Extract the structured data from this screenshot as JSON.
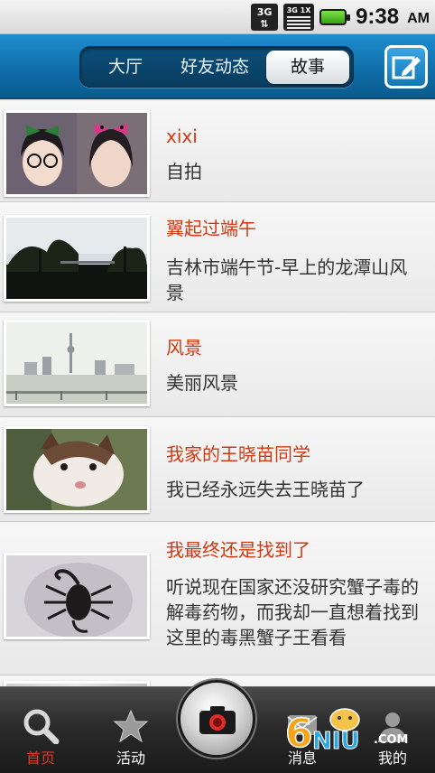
{
  "status_bar": {
    "network": "3G",
    "signal_tag": "3G 1X",
    "time": "9:38",
    "ampm": "AM"
  },
  "header": {
    "tabs": [
      "大厅",
      "好友动态",
      "故事"
    ],
    "active_tab": "故事",
    "compose_icon": "compose-icon"
  },
  "stories": [
    {
      "title": "xixi",
      "description": "自拍"
    },
    {
      "title": "翼起过端午",
      "description": "吉林市端午节-早上的龙潭山风景"
    },
    {
      "title": "风景",
      "description": "美丽风景"
    },
    {
      "title": "我家的王晓苗同学",
      "description": "我已经永远失去王晓苗了"
    },
    {
      "title": "我最终还是找到了",
      "description": "听说现在国家还没研究蟹子毒的解毒药物，而我却一直想着找到这里的毒黑蟹子王看看"
    }
  ],
  "tab_bar": {
    "items": [
      {
        "label": "首页",
        "icon": "search-icon",
        "active": true
      },
      {
        "label": "活动",
        "icon": "star-icon",
        "active": false
      },
      {
        "label": "",
        "icon": "camera-icon",
        "active": false
      },
      {
        "label": "消息",
        "icon": "message-icon",
        "active": false
      },
      {
        "label": "我的",
        "icon": "profile-icon",
        "active": false
      }
    ]
  },
  "watermark": {
    "text": "6NIU.COM"
  },
  "colors": {
    "header_blue": "#1476b6",
    "title_red": "#d03a12",
    "active_tab_label": "#e0382a"
  }
}
